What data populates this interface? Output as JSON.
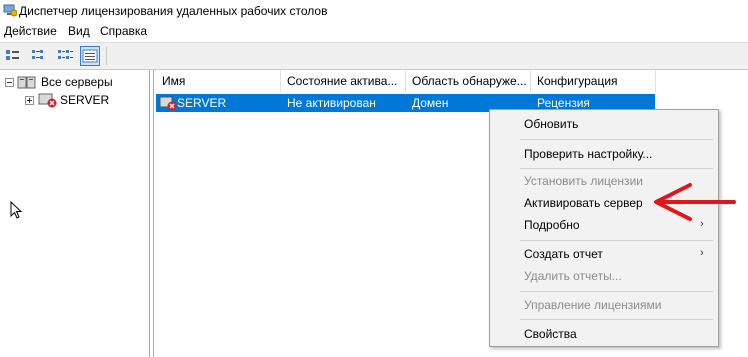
{
  "window": {
    "title": "Диспетчер лицензирования удаленных рабочих столов"
  },
  "menu": {
    "items": [
      "Действие",
      "Вид",
      "Справка"
    ]
  },
  "toolbar": {
    "buttons": [
      "view-large-icon",
      "view-small-icon",
      "view-list-icon",
      "view-details-icon"
    ]
  },
  "tree": {
    "root_label": "Все серверы",
    "child_label": "SERVER"
  },
  "list": {
    "columns": [
      "Имя",
      "Состояние актива...",
      "Область обнаруже...",
      "Конфигурация"
    ],
    "rows": [
      {
        "name": "SERVER",
        "state": "Не активирован",
        "scope": "Домен",
        "config": "Рецензия"
      }
    ]
  },
  "context_menu": {
    "items": [
      {
        "label": "Обновить",
        "enabled": true
      },
      {
        "label": "Проверить настройку...",
        "enabled": true
      },
      {
        "label": "Установить лицензии",
        "enabled": false
      },
      {
        "label": "Активировать сервер",
        "enabled": true
      },
      {
        "label": "Подробно",
        "enabled": true,
        "submenu": true
      },
      {
        "label": "Создать отчет",
        "enabled": true,
        "submenu": true
      },
      {
        "label": "Удалить отчеты...",
        "enabled": false
      },
      {
        "label": "Управление лицензиями",
        "enabled": false
      },
      {
        "label": "Свойства",
        "enabled": true
      }
    ]
  },
  "colors": {
    "selection": "#0078d7",
    "annotation_arrow": "#e3141b"
  }
}
